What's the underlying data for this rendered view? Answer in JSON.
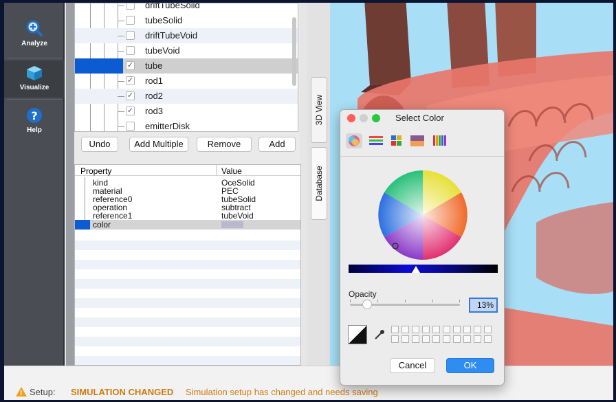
{
  "sidebar": {
    "items": [
      {
        "label": "Analyze",
        "icon": "zoom-in-icon"
      },
      {
        "label": "Visualize",
        "icon": "cube-icon"
      },
      {
        "label": "Help",
        "icon": "question-icon"
      }
    ]
  },
  "tree": {
    "rows": [
      {
        "label": "driftTubeSolid",
        "checked": false
      },
      {
        "label": "tubeSolid",
        "checked": false
      },
      {
        "label": "driftTubeVoid",
        "checked": false
      },
      {
        "label": "tubeVoid",
        "checked": false
      },
      {
        "label": "tube",
        "checked": true,
        "selected": true
      },
      {
        "label": "rod1",
        "checked": true
      },
      {
        "label": "rod2",
        "checked": true
      },
      {
        "label": "rod3",
        "checked": true
      },
      {
        "label": "emitterDisk",
        "checked": false
      }
    ],
    "check_mark": "✓"
  },
  "buttons": {
    "undo": "Undo",
    "add_multiple": "Add Multiple",
    "remove": "Remove",
    "add": "Add"
  },
  "properties": {
    "header_property": "Property",
    "header_value": "Value",
    "rows": [
      {
        "name": "kind",
        "value": "OceSolid"
      },
      {
        "name": "material",
        "value": "PEC"
      },
      {
        "name": "reference0",
        "value": "tubeSolid"
      },
      {
        "name": "operation",
        "value": "subtract"
      },
      {
        "name": "reference1",
        "value": "tubeVoid"
      },
      {
        "name": "color",
        "value": ""
      }
    ],
    "color_swatch": "#b8b8cf"
  },
  "tabs": {
    "view3d": "3D View",
    "database": "Database"
  },
  "dialog": {
    "title": "Select Color",
    "opacity_label": "Opacity",
    "opacity_value": "13%",
    "opacity_fraction": 0.13,
    "cancel": "Cancel",
    "ok": "OK",
    "modes": [
      "color-wheel-icon",
      "color-sliders-icon",
      "color-palettes-icon",
      "image-palettes-icon",
      "pencils-icon"
    ]
  },
  "status": {
    "prefix": "Setup:",
    "title": "SIMULATION CHANGED",
    "message": "Simulation setup has changed and needs saving"
  },
  "colors": {
    "accent": "#2f8cf0",
    "selection": "#0b5bd3",
    "warning": "#d07a10",
    "viewport_bg": "#a8dff6",
    "model": "#e8766a"
  }
}
